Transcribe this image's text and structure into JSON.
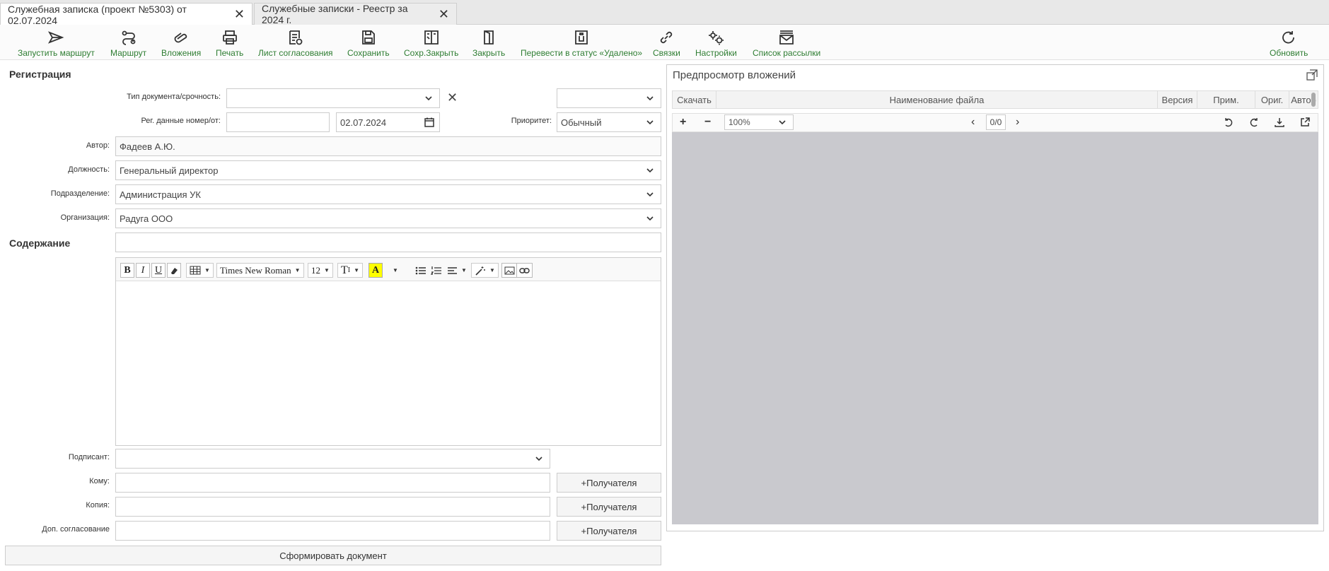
{
  "tabs": [
    {
      "label": "Служебная записка (проект №5303) от 02.07.2024"
    },
    {
      "label": "Служебные записки - Реестр за 2024 г."
    }
  ],
  "toolbar": {
    "start_route": "Запустить маршрут",
    "route": "Маршрут",
    "attachments": "Вложения",
    "print": "Печать",
    "approval_sheet": "Лист согласования",
    "save": "Сохранить",
    "save_close": "Сохр.Закрыть",
    "close": "Закрыть",
    "set_deleted": "Перевести в статус «Удалено»",
    "links": "Связки",
    "settings": "Настройки",
    "mailing_list": "Список рассылки",
    "refresh": "Обновить"
  },
  "form": {
    "registration_title": "Регистрация",
    "doc_type_label": "Тип документа/срочность:",
    "doc_type_value": "",
    "urgency_value": "",
    "reg_data_label": "Рег. данные номер/от:",
    "reg_number_value": "",
    "reg_date_value": "02.07.2024",
    "priority_label": "Приоритет:",
    "priority_value": "Обычный",
    "author_label": "Автор:",
    "author_value": "Фадеев А.Ю.",
    "position_label": "Должность:",
    "position_value": "Генеральный директор",
    "department_label": "Подразделение:",
    "department_value": "Администрация УК",
    "organization_label": "Организация:",
    "organization_value": "Радуга ООО",
    "content_title": "Содержание",
    "subject_value": "",
    "signer_label": "Подписант:",
    "signer_value": "",
    "to_label": "Кому:",
    "copy_label": "Копия:",
    "extra_approval_label": "Доп. согласование",
    "add_recipients": "+Получателя",
    "generate_doc": "Сформировать документ"
  },
  "editor": {
    "bold": "B",
    "italic": "I",
    "underline": "U",
    "font_family": "Times New Roman",
    "font_size": "12",
    "text_style": "T",
    "text_color": "A"
  },
  "preview": {
    "title": "Предпросмотр вложений",
    "columns": [
      "Скачать",
      "Наименование файла",
      "Версия",
      "Прим.",
      "Ориг.",
      "Автор"
    ],
    "zoom": "100%",
    "page": "0/0"
  }
}
